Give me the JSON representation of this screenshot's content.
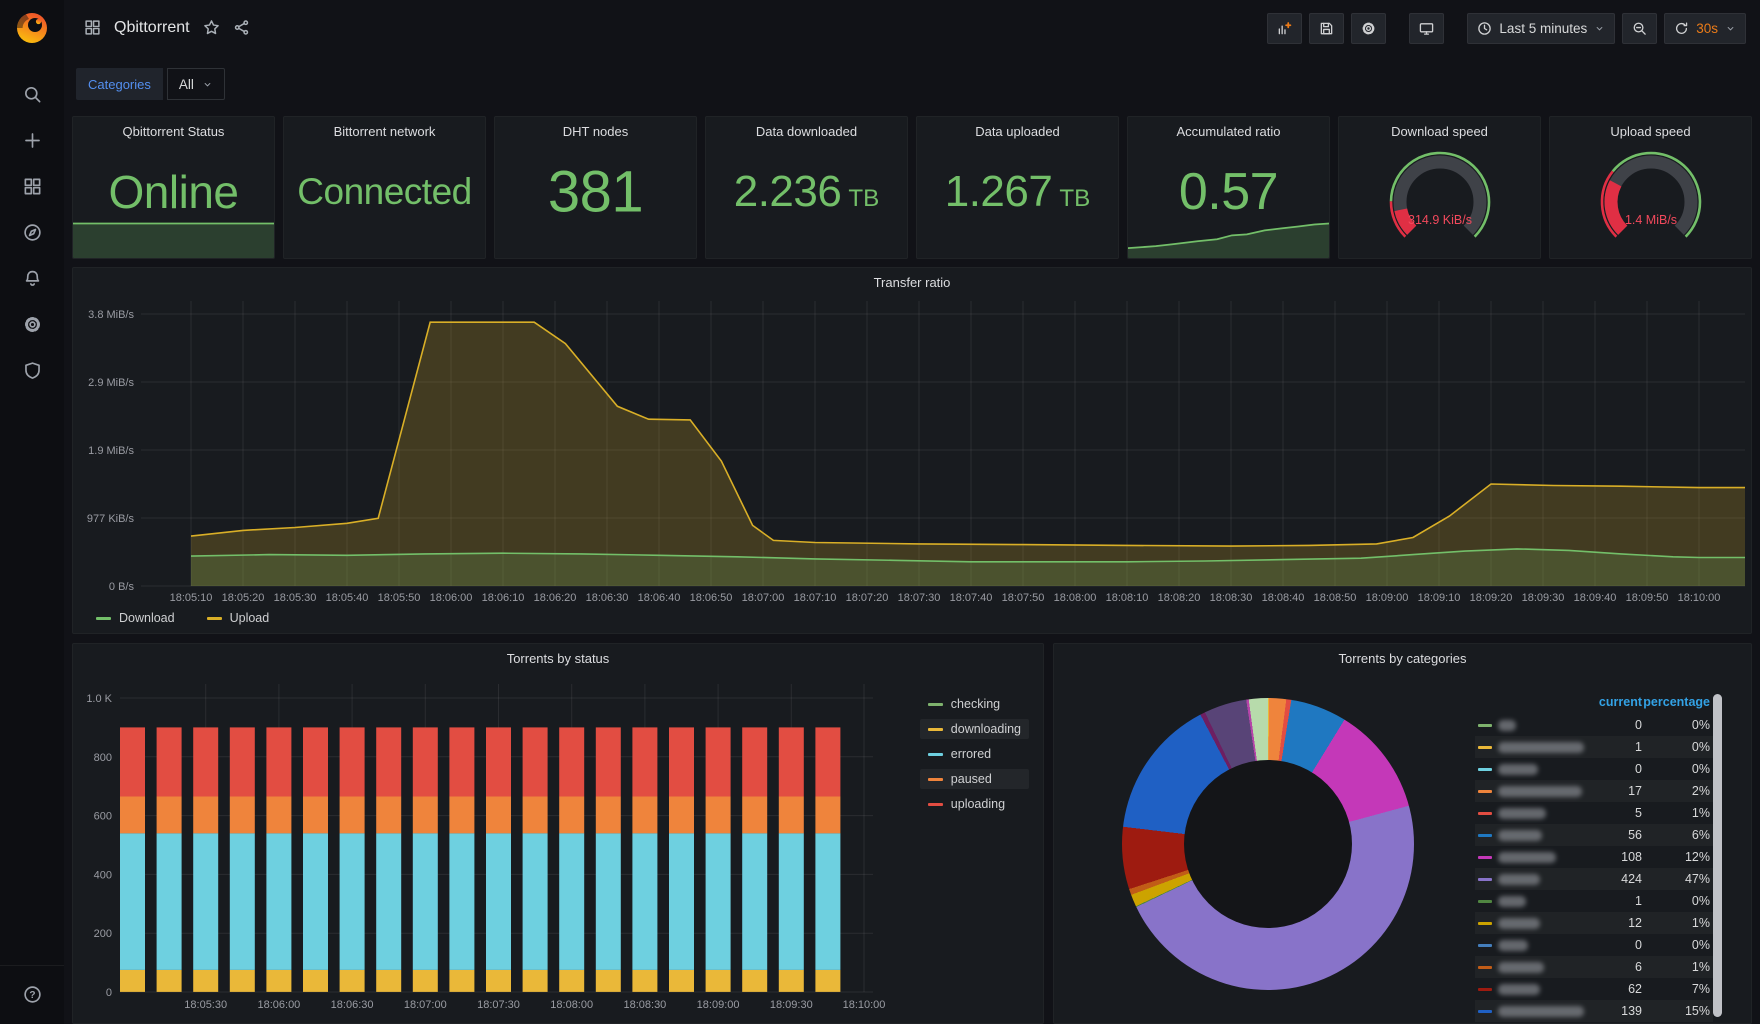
{
  "app": {
    "accent_orange": "#eb7b18",
    "green": "#73bf69",
    "red": "#f2495c",
    "link_blue": "#33a2e5"
  },
  "sidebar": {
    "icons": [
      "search",
      "add",
      "dashboards",
      "explore",
      "alerting",
      "settings",
      "shield"
    ],
    "bottom_icons": [
      "help"
    ]
  },
  "header": {
    "title": "Qbittorrent",
    "toolbar": {
      "time_range_label": "Last 5 minutes",
      "refresh_label": "30s",
      "buttons": [
        {
          "icon": "add-panel"
        },
        {
          "icon": "save"
        },
        {
          "icon": "settings"
        },
        {
          "icon": "tv",
          "gap_before": 16
        },
        {
          "icon": "clock",
          "label_key": "time_range_label",
          "caret": true,
          "gap_before": 16
        },
        {
          "icon": "zoom-out"
        },
        {
          "icon": "refresh",
          "label_key": "refresh_label",
          "caret": true,
          "label_color": "orange"
        }
      ]
    }
  },
  "submenu": {
    "filter_label": "Categories",
    "filter_value": "All"
  },
  "stats": [
    {
      "title": "Qbittorrent Status",
      "type": "text",
      "value": "Online",
      "color": "#73bf69",
      "sparkline": "flat"
    },
    {
      "title": "Bittorrent network",
      "type": "text",
      "value": "Connected",
      "color": "#73bf69"
    },
    {
      "title": "DHT nodes",
      "type": "text",
      "value": "381",
      "color": "#73bf69"
    },
    {
      "title": "Data downloaded",
      "type": "text",
      "value": "2.236",
      "suffix": "TB",
      "color": "#73bf69"
    },
    {
      "title": "Data uploaded",
      "type": "text",
      "value": "1.267",
      "suffix": "TB",
      "color": "#73bf69"
    },
    {
      "title": "Accumulated ratio",
      "type": "text",
      "value": "0.57",
      "color": "#73bf69",
      "sparkline": "rising"
    },
    {
      "title": "Download speed",
      "type": "gauge",
      "value": "314.9 KiB/s",
      "color": "#f2495c",
      "gauge": {
        "value_pct": 0.125,
        "band_pct": 0.17
      }
    },
    {
      "title": "Upload speed",
      "type": "gauge",
      "value": "1.4 MiB/s",
      "color": "#f2495c",
      "gauge": {
        "value_pct": 0.27,
        "band_pct": 0.31
      }
    }
  ],
  "chart_data": [
    {
      "id": "transfer",
      "type": "area",
      "title": "Transfer ratio",
      "unit": "MiB/s",
      "ylim": [
        0,
        4.0
      ],
      "grid": true,
      "legend_position": "bottom",
      "y_ticks": [
        {
          "v": 0,
          "label": "0 B/s"
        },
        {
          "v": 0.9537,
          "label": "977 KiB/s"
        },
        {
          "v": 1.9073,
          "label": "1.9 MiB/s"
        },
        {
          "v": 2.861,
          "label": "2.9 MiB/s"
        },
        {
          "v": 3.8147,
          "label": "3.8 MiB/s"
        }
      ],
      "x_ticks": [
        "18:05:10",
        "18:05:20",
        "18:05:30",
        "18:05:40",
        "18:05:50",
        "18:06:00",
        "18:06:10",
        "18:06:20",
        "18:06:30",
        "18:06:40",
        "18:06:50",
        "18:07:00",
        "18:07:10",
        "18:07:20",
        "18:07:30",
        "18:07:40",
        "18:07:50",
        "18:08:00",
        "18:08:10",
        "18:08:20",
        "18:08:30",
        "18:08:40",
        "18:08:50",
        "18:09:00",
        "18:09:10",
        "18:09:20",
        "18:09:30",
        "18:09:40",
        "18:09:50",
        "18:10:00"
      ],
      "x_step_seconds": 10,
      "series": [
        {
          "name": "Download",
          "color": "#73bf69",
          "points": [
            [
              0,
              0.42
            ],
            [
              15,
              0.44
            ],
            [
              30,
              0.43
            ],
            [
              45,
              0.45
            ],
            [
              60,
              0.46
            ],
            [
              75,
              0.45
            ],
            [
              90,
              0.43
            ],
            [
              105,
              0.41
            ],
            [
              120,
              0.38
            ],
            [
              135,
              0.36
            ],
            [
              150,
              0.34
            ],
            [
              165,
              0.34
            ],
            [
              180,
              0.34
            ],
            [
              195,
              0.35
            ],
            [
              210,
              0.37
            ],
            [
              225,
              0.39
            ],
            [
              235,
              0.44
            ],
            [
              245,
              0.49
            ],
            [
              255,
              0.52
            ],
            [
              265,
              0.5
            ],
            [
              275,
              0.45
            ],
            [
              285,
              0.41
            ],
            [
              290,
              0.4
            ]
          ]
        },
        {
          "name": "Upload",
          "color": "#d9af27",
          "points": [
            [
              0,
              0.7
            ],
            [
              10,
              0.78
            ],
            [
              20,
              0.82
            ],
            [
              30,
              0.88
            ],
            [
              36,
              0.95
            ],
            [
              46,
              3.7
            ],
            [
              66,
              3.7
            ],
            [
              72,
              3.4
            ],
            [
              82,
              2.52
            ],
            [
              88,
              2.34
            ],
            [
              96,
              2.33
            ],
            [
              102,
              1.75
            ],
            [
              108,
              0.85
            ],
            [
              112,
              0.64
            ],
            [
              120,
              0.61
            ],
            [
              140,
              0.59
            ],
            [
              160,
              0.58
            ],
            [
              180,
              0.57
            ],
            [
              200,
              0.56
            ],
            [
              215,
              0.57
            ],
            [
              228,
              0.59
            ],
            [
              235,
              0.68
            ],
            [
              242,
              0.98
            ],
            [
              250,
              1.43
            ],
            [
              262,
              1.41
            ],
            [
              275,
              1.4
            ],
            [
              290,
              1.38
            ]
          ]
        }
      ]
    },
    {
      "id": "status",
      "type": "bar",
      "stacked": true,
      "title": "Torrents by status",
      "ylim": [
        0,
        1040
      ],
      "grid": true,
      "legend_position": "right",
      "bar_count": 20,
      "y_ticks": [
        {
          "v": 0,
          "label": "0"
        },
        {
          "v": 200,
          "label": "200"
        },
        {
          "v": 400,
          "label": "400"
        },
        {
          "v": 600,
          "label": "600"
        },
        {
          "v": 800,
          "label": "800"
        },
        {
          "v": 1000,
          "label": "1.0 K"
        }
      ],
      "x_ticks": [
        "18:05:30",
        "18:06:00",
        "18:06:30",
        "18:07:00",
        "18:07:30",
        "18:08:00",
        "18:08:30",
        "18:09:00",
        "18:09:30",
        "18:10:00"
      ],
      "note": "every bar has the same stacked values over the whole window",
      "series": [
        {
          "name": "checking",
          "color": "#7eb26d",
          "value": 0
        },
        {
          "name": "downloading",
          "color": "#eab839",
          "value": 75,
          "legend_highlight": true
        },
        {
          "name": "errored",
          "color": "#6ed0e0",
          "value": 465
        },
        {
          "name": "paused",
          "color": "#ef843c",
          "value": 125,
          "legend_highlight": true
        },
        {
          "name": "uploading",
          "color": "#e24d42",
          "value": 235
        }
      ]
    },
    {
      "id": "categories",
      "type": "pie",
      "title": "Torrents by categories",
      "table_columns": [
        "current",
        "percentage"
      ],
      "header_color": "#33a2e5",
      "labels_redacted": true,
      "total": 900,
      "rows": [
        {
          "color": "#7eb26d",
          "current": 0,
          "percentage": "0%",
          "label_width": 18
        },
        {
          "color": "#eab839",
          "current": 1,
          "percentage": "0%",
          "label_width": 92
        },
        {
          "color": "#6ed0e0",
          "current": 0,
          "percentage": "0%",
          "label_width": 40
        },
        {
          "color": "#ef843c",
          "current": 17,
          "percentage": "2%",
          "label_width": 84
        },
        {
          "color": "#e24d42",
          "current": 5,
          "percentage": "1%",
          "label_width": 48
        },
        {
          "color": "#1f78c1",
          "current": 56,
          "percentage": "6%",
          "label_width": 44
        },
        {
          "color": "#c438b8",
          "current": 108,
          "percentage": "12%",
          "label_width": 58
        },
        {
          "color": "#8873c9",
          "current": 424,
          "percentage": "47%",
          "label_width": 42
        },
        {
          "color": "#508642",
          "current": 1,
          "percentage": "0%",
          "label_width": 28
        },
        {
          "color": "#cca300",
          "current": 12,
          "percentage": "1%",
          "label_width": 42
        },
        {
          "color": "#447ebc",
          "current": 0,
          "percentage": "0%",
          "label_width": 30
        },
        {
          "color": "#c15c17",
          "current": 6,
          "percentage": "1%",
          "label_width": 46
        },
        {
          "color": "#9e1b10",
          "current": 62,
          "percentage": "7%",
          "label_width": 42
        },
        {
          "color": "#1f60c4",
          "current": 139,
          "percentage": "15%",
          "label_width": 96
        }
      ],
      "hidden_slices": [
        {
          "color": "#6d1f62",
          "deg": 2
        },
        {
          "color": "#584477",
          "deg": 17
        },
        {
          "color": "#b545a8",
          "deg": 1
        },
        {
          "color": "#b7dbab",
          "deg": 8
        }
      ]
    }
  ]
}
